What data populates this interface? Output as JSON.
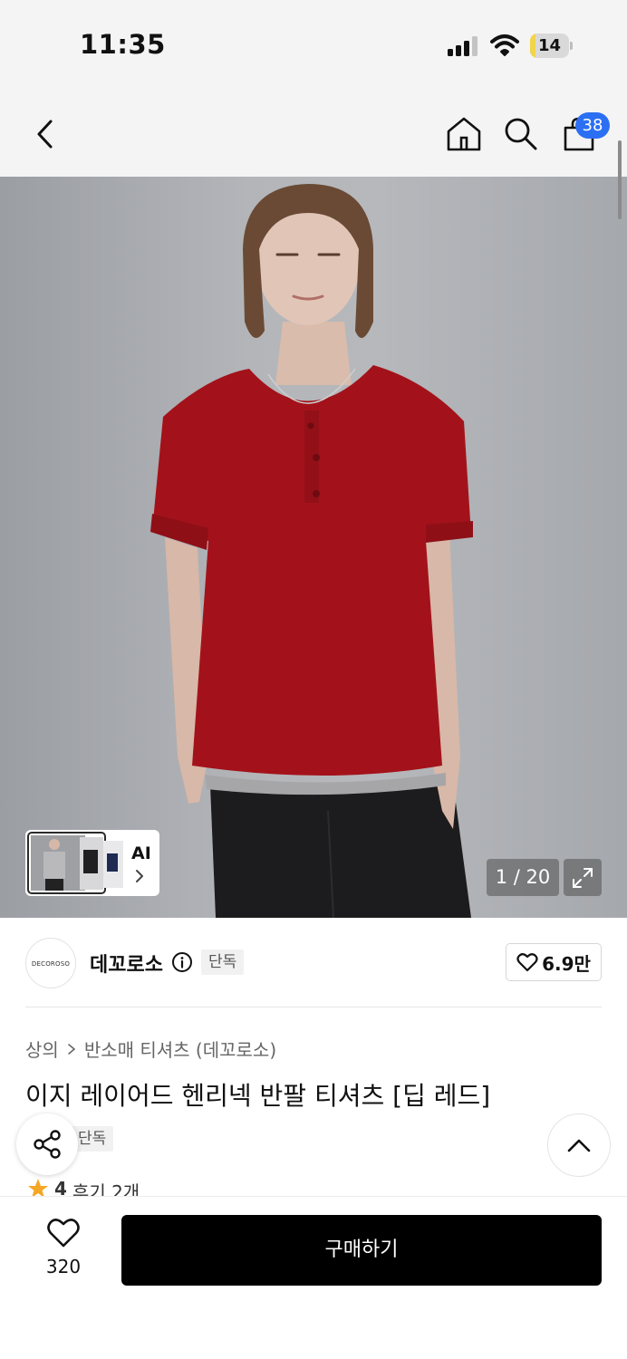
{
  "status_bar": {
    "time": "11:35",
    "battery": "14",
    "battery_level": 0.14,
    "icons": [
      "signal-icon",
      "wifi-icon",
      "battery-icon"
    ]
  },
  "header": {
    "icons": [
      "back-icon",
      "home-icon",
      "search-icon",
      "cart-icon"
    ],
    "cart_count": "38"
  },
  "gallery": {
    "ai_label": "AI",
    "counter": "1 / 20",
    "icons": [
      "chevron-right-icon",
      "expand-icon"
    ]
  },
  "brand": {
    "logo_text": "DECOROSO",
    "name": "데꼬로소",
    "badge": "단독",
    "like_count": "6.9만",
    "icons": [
      "info-icon",
      "heart-icon"
    ]
  },
  "product": {
    "breadcrumb": [
      "상의",
      "반소매 티셔츠 (데꼬로소)"
    ],
    "title": "이지 레이어드 헨리넥 반팔 티셔츠 [딥 레드]",
    "badge": "단독",
    "rating": "4",
    "reviews": "후기 2개",
    "icons": [
      "share-icon",
      "chevron-up-icon",
      "star-icon"
    ]
  },
  "bottom_bar": {
    "wish_count": "320",
    "buy_label": "구매하기",
    "icons": [
      "heart-icon"
    ]
  },
  "colors": {
    "accent_blue": "#2b6ff3",
    "shirt_red": "#a3121a",
    "star": "#f5a623",
    "buy_button": "#000000"
  }
}
